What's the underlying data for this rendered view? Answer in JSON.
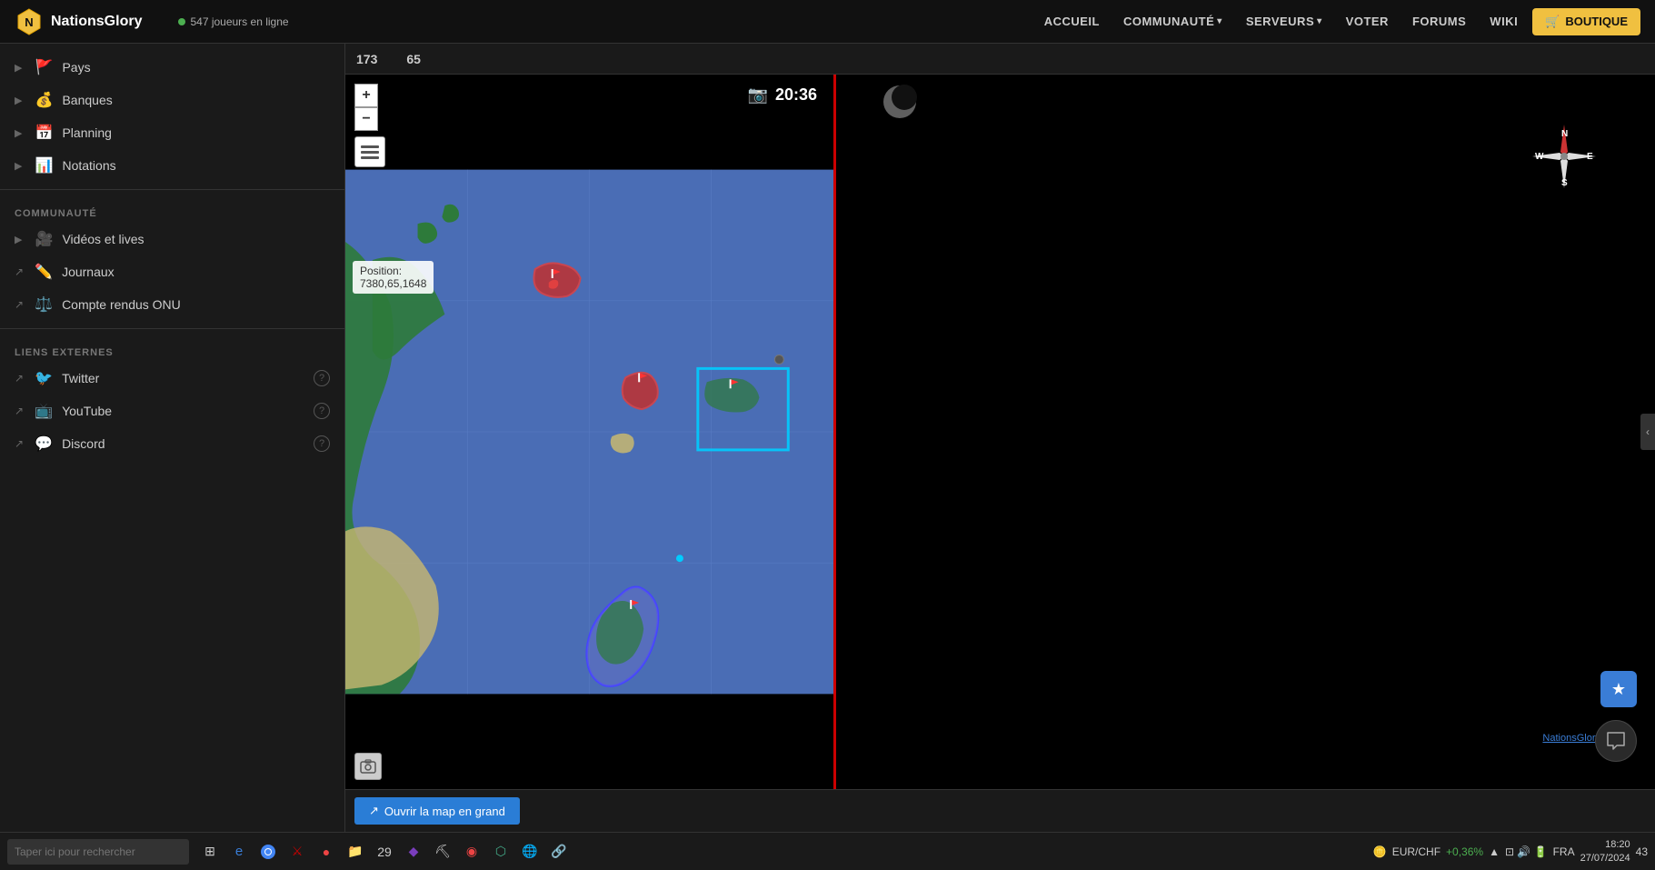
{
  "topnav": {
    "logo_text": "NationsGlory",
    "online_count": "547 joueurs en ligne",
    "links": [
      {
        "label": "ACCUEIL",
        "dropdown": false
      },
      {
        "label": "COMMUNAUTÉ",
        "dropdown": true
      },
      {
        "label": "SERVEURS",
        "dropdown": true
      },
      {
        "label": "VOTER",
        "dropdown": false
      },
      {
        "label": "FORUMS",
        "dropdown": false
      },
      {
        "label": "WIKI",
        "dropdown": false
      }
    ],
    "boutique_label": "BOUTIQUE"
  },
  "sidebar": {
    "items_main": [
      {
        "icon": "🚩",
        "label": "Pays",
        "expandable": true,
        "external": false
      },
      {
        "icon": "💰",
        "label": "Banques",
        "expandable": true,
        "external": false
      },
      {
        "icon": "📅",
        "label": "Planning",
        "expandable": true,
        "external": false
      },
      {
        "icon": "📊",
        "label": "Notations",
        "expandable": true,
        "external": false
      }
    ],
    "communaute_label": "COMMUNAUTÉ",
    "items_communaute": [
      {
        "icon": "🎥",
        "label": "Vidéos et lives",
        "expandable": true,
        "external": false
      },
      {
        "icon": "✏️",
        "label": "Journaux",
        "expandable": false,
        "external": true
      },
      {
        "icon": "⚖️",
        "label": "Compte rendus ONU",
        "expandable": false,
        "external": true
      }
    ],
    "liens_externes_label": "LIENS EXTERNES",
    "items_externes": [
      {
        "icon": "🐦",
        "label": "Twitter",
        "external": true,
        "help": true
      },
      {
        "icon": "📺",
        "label": "YouTube",
        "external": true,
        "help": true
      },
      {
        "icon": "💬",
        "label": "Discord",
        "external": true,
        "help": true
      }
    ]
  },
  "map": {
    "coord_x": "173",
    "coord_y": "65",
    "time": "20:36",
    "position_label": "Position:",
    "position_value": "7380,65,1648",
    "open_map_label": "Ouvrir la map en grand",
    "watermark": "NationsGlory"
  },
  "taskbar": {
    "search_placeholder": "Taper ici pour rechercher",
    "currency": "EUR/CHF",
    "currency_change": "+0,36%",
    "time": "18:20",
    "date": "27/07/2024",
    "lang": "FRA",
    "battery": "43"
  },
  "compass": {
    "n": "N",
    "s": "S",
    "e": "E",
    "w": "W"
  }
}
